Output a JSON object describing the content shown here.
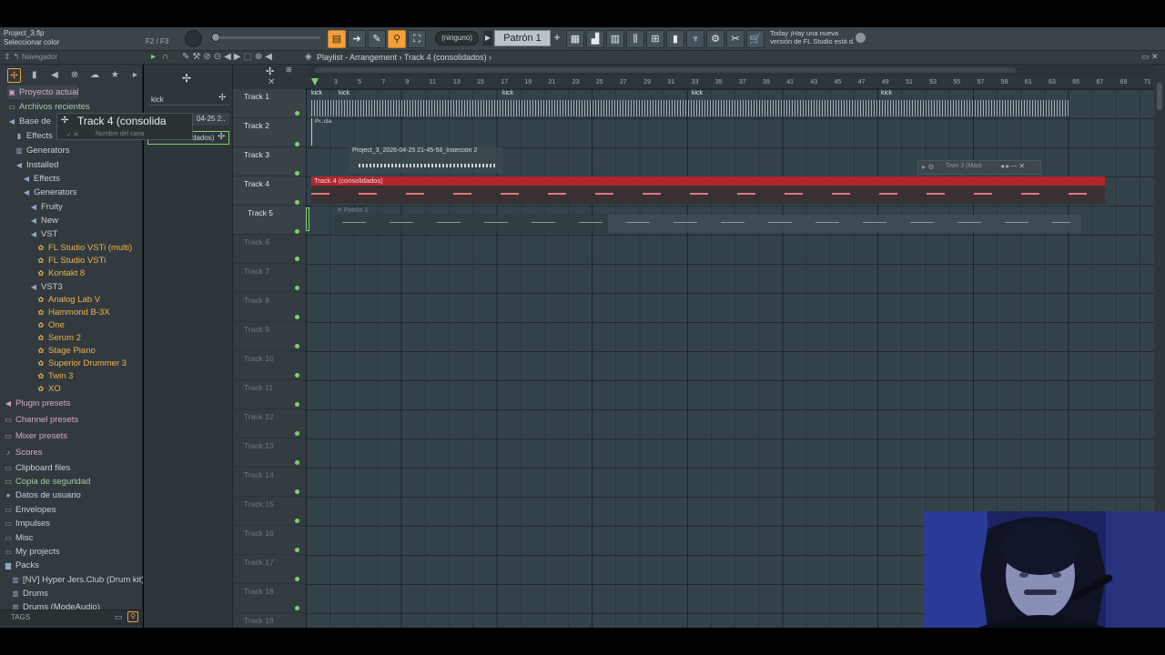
{
  "project": {
    "filename": "Project_3.flp",
    "status": "Seleccionar color",
    "fkeys": "F2 / F3"
  },
  "toolbar": {
    "pattern_mode": "(ninguno)",
    "pattern_name": "Patrón 1",
    "news_line1": "Today ¡Hay una nueva",
    "news_line2": "versión de FL Studio está d."
  },
  "browser": {
    "title": "Navegador",
    "items": [
      {
        "label": "Proyecto actual",
        "kind": "pink",
        "icon": "project-icon",
        "glyph": "▣"
      },
      {
        "label": "Archivos recientes",
        "kind": "green",
        "icon": "folder-icon",
        "glyph": "▭"
      },
      {
        "label": "Base de",
        "kind": "",
        "icon": "plugin-db-icon",
        "glyph": "◀"
      },
      {
        "label": "Effects",
        "kind": "",
        "icon": "folder-icon",
        "glyph": "▮"
      },
      {
        "label": "Generators",
        "kind": "",
        "icon": "folder-icon",
        "glyph": "▥"
      },
      {
        "label": "Installed",
        "kind": "",
        "icon": "plug-icon",
        "glyph": "◀"
      },
      {
        "label": "Effects",
        "kind": "",
        "icon": "plug-icon",
        "glyph": "◀"
      },
      {
        "label": "Generators",
        "kind": "",
        "icon": "plug-icon",
        "glyph": "◀"
      },
      {
        "label": "Fruity",
        "kind": "",
        "icon": "plug-icon",
        "glyph": "◀"
      },
      {
        "label": "New",
        "kind": "",
        "icon": "plug-icon",
        "glyph": "◀"
      },
      {
        "label": "VST",
        "kind": "",
        "icon": "plug-icon",
        "glyph": "◀"
      },
      {
        "label": "FL Studio VSTi (multi)",
        "kind": "plugin",
        "icon": "plugin-icon",
        "glyph": "✿"
      },
      {
        "label": "FL Studio VSTi",
        "kind": "plugin",
        "icon": "plugin-icon",
        "glyph": "✿"
      },
      {
        "label": "Kontakt 8",
        "kind": "plugin",
        "icon": "plugin-icon",
        "glyph": "✿"
      },
      {
        "label": "VST3",
        "kind": "",
        "icon": "plug-icon",
        "glyph": "◀"
      },
      {
        "label": "Analog Lab V",
        "kind": "plugin",
        "icon": "plugin-icon",
        "glyph": "✿"
      },
      {
        "label": "Hammond B-3X",
        "kind": "plugin",
        "icon": "plugin-icon",
        "glyph": "✿"
      },
      {
        "label": "One",
        "kind": "plugin",
        "icon": "plugin-icon",
        "glyph": "✿"
      },
      {
        "label": "Serum 2",
        "kind": "plugin",
        "icon": "plugin-icon",
        "glyph": "✿"
      },
      {
        "label": "Stage Piano",
        "kind": "plugin",
        "icon": "plugin-icon",
        "glyph": "✿"
      },
      {
        "label": "Superior Drummer 3",
        "kind": "plugin",
        "icon": "plugin-icon",
        "glyph": "✿"
      },
      {
        "label": "Twin 3",
        "kind": "plugin",
        "icon": "plugin-icon",
        "glyph": "✿"
      },
      {
        "label": "XO",
        "kind": "plugin",
        "icon": "plugin-icon",
        "glyph": "✿"
      },
      {
        "label": "Plugin presets",
        "kind": "pink",
        "icon": "preset-icon",
        "glyph": "◀"
      },
      {
        "label": "Channel presets",
        "kind": "pink",
        "icon": "preset-icon",
        "glyph": "▭"
      },
      {
        "label": "Mixer presets",
        "kind": "pink",
        "icon": "preset-icon",
        "glyph": "▭"
      },
      {
        "label": "Scores",
        "kind": "pink",
        "icon": "note-icon",
        "glyph": "♪"
      },
      {
        "label": "Clipboard files",
        "kind": "",
        "icon": "folder-icon",
        "glyph": "▭"
      },
      {
        "label": "Copia de seguridad",
        "kind": "green",
        "icon": "folder-icon",
        "glyph": "▭"
      },
      {
        "label": "Datos de usuario",
        "kind": "",
        "icon": "user-icon",
        "glyph": "●"
      },
      {
        "label": "Envelopes",
        "kind": "",
        "icon": "folder-icon",
        "glyph": "▭"
      },
      {
        "label": "Impulses",
        "kind": "",
        "icon": "folder-icon",
        "glyph": "▭"
      },
      {
        "label": "Misc",
        "kind": "",
        "icon": "folder-icon",
        "glyph": "▭"
      },
      {
        "label": "My projects",
        "kind": "",
        "icon": "folder-icon",
        "glyph": "▭"
      },
      {
        "label": "Packs",
        "kind": "",
        "icon": "folder-icon",
        "glyph": "▆"
      },
      {
        "label": "[NV] Hyper Jers.Club (Drum kit)",
        "kind": "",
        "icon": "folder-icon",
        "glyph": "▥"
      },
      {
        "label": "Drums",
        "kind": "",
        "icon": "folder-icon",
        "glyph": "▥"
      },
      {
        "label": "Drums (ModeAudio)",
        "kind": "",
        "icon": "folder-icon",
        "glyph": "▥"
      }
    ],
    "tags_label": "TAGS"
  },
  "picker": {
    "search_value": "kick",
    "item1": "04-25 2..",
    "item2": "dados)",
    "tooltip_title": "Track 4 (consolida",
    "tooltip_sub": "Nombre del cana"
  },
  "playlist": {
    "title": "Playlist - Arrangement",
    "breadcrumb": "Track 4 (consolidados)",
    "bars": [
      "3",
      "5",
      "7",
      "9",
      "11",
      "13",
      "15",
      "17",
      "19",
      "21",
      "23",
      "25",
      "27",
      "29",
      "31",
      "33",
      "35",
      "37",
      "39",
      "41",
      "43",
      "45",
      "47",
      "49",
      "51",
      "53",
      "55",
      "57",
      "59",
      "61",
      "63",
      "65",
      "67",
      "69",
      "71"
    ],
    "tracks": [
      "Track 1",
      "Track 2",
      "Track 3",
      "Track 4",
      "Track 5",
      "Track 6",
      "Track 7",
      "Track 8",
      "Track 9",
      "Track 10",
      "Track 11",
      "Track 12",
      "Track 13",
      "Track 14",
      "Track 15",
      "Track 16",
      "Track 17",
      "Track 18",
      "Track 19"
    ],
    "clips": {
      "kick": "kick",
      "pr_cla": "Pr..cla",
      "insercion": "Project_3_2026-04-25 21-45-58_Inserción 2",
      "track4": "Track 4 (consolidados)",
      "patron": "Patrón 1"
    },
    "plugin_window": "Twin 3 (Mast"
  },
  "colors": {
    "accent": "#f2a13a",
    "track4_clip": "#b3262f",
    "led": "#7bd36a",
    "grid": "#34424a"
  }
}
